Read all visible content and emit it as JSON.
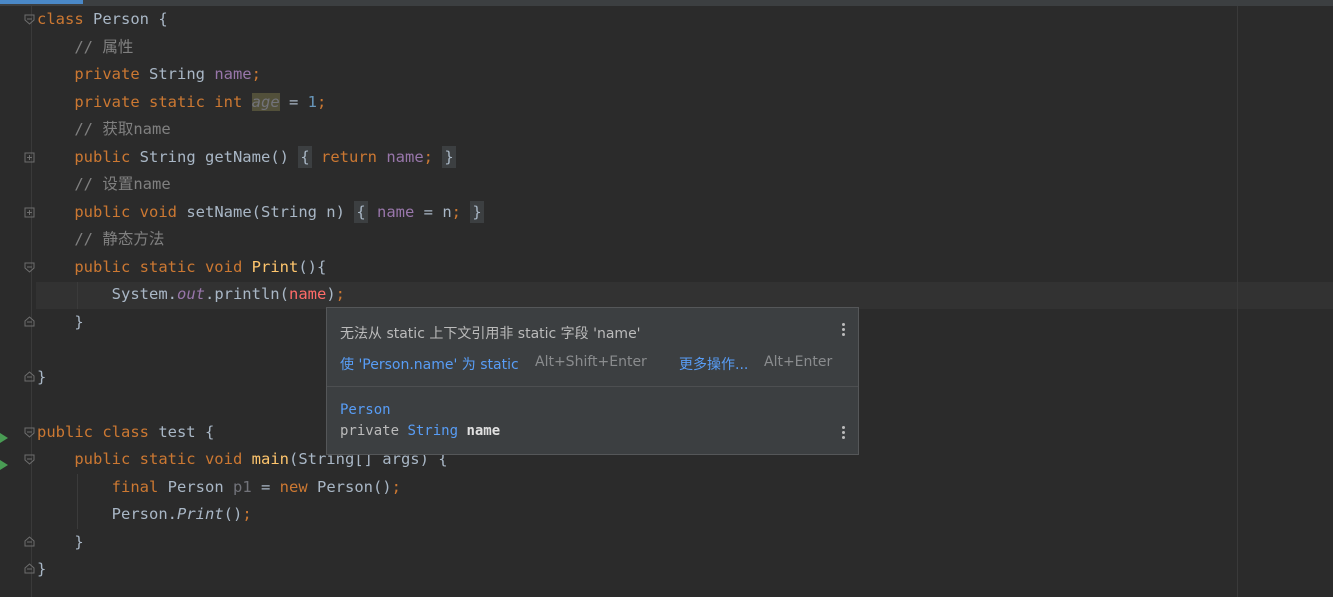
{
  "editor": {
    "lines": [
      {
        "tokens": [
          {
            "c": "kw",
            "t": "class"
          },
          {
            "c": "",
            "t": " Person {"
          }
        ]
      },
      {
        "tokens": [
          {
            "c": "",
            "t": "    "
          },
          {
            "c": "cm",
            "t": "// 属性"
          }
        ]
      },
      {
        "tokens": [
          {
            "c": "",
            "t": "    "
          },
          {
            "c": "kw",
            "t": "private"
          },
          {
            "c": "",
            "t": " String "
          },
          {
            "c": "fld",
            "t": "name"
          },
          {
            "c": "kw",
            "t": ";"
          }
        ]
      },
      {
        "tokens": [
          {
            "c": "",
            "t": "    "
          },
          {
            "c": "kw",
            "t": "private static int"
          },
          {
            "c": "",
            "t": " "
          },
          {
            "c": "hl-age",
            "t": "age"
          },
          {
            "c": "",
            "t": " = "
          },
          {
            "c": "num",
            "t": "1"
          },
          {
            "c": "kw",
            "t": ";"
          }
        ]
      },
      {
        "tokens": [
          {
            "c": "",
            "t": "    "
          },
          {
            "c": "cm",
            "t": "// 获取name"
          }
        ]
      },
      {
        "tokens": [
          {
            "c": "",
            "t": "    "
          },
          {
            "c": "kw",
            "t": "public"
          },
          {
            "c": "",
            "t": " String "
          },
          {
            "c": "mthg",
            "t": "getName"
          },
          {
            "c": "",
            "t": "() "
          },
          {
            "c": "fold-box",
            "t": "{"
          },
          {
            "c": "",
            "t": " "
          },
          {
            "c": "kw",
            "t": "return"
          },
          {
            "c": "",
            "t": " "
          },
          {
            "c": "fld",
            "t": "name"
          },
          {
            "c": "kw",
            "t": ";"
          },
          {
            "c": "",
            "t": " "
          },
          {
            "c": "fold-box",
            "t": "}"
          }
        ]
      },
      {
        "tokens": [
          {
            "c": "",
            "t": "    "
          },
          {
            "c": "cm",
            "t": "// 设置name"
          }
        ]
      },
      {
        "tokens": [
          {
            "c": "",
            "t": "    "
          },
          {
            "c": "kw",
            "t": "public void"
          },
          {
            "c": "",
            "t": " "
          },
          {
            "c": "mthg",
            "t": "setName"
          },
          {
            "c": "",
            "t": "(String n) "
          },
          {
            "c": "fold-box",
            "t": "{"
          },
          {
            "c": "",
            "t": " "
          },
          {
            "c": "fld",
            "t": "name"
          },
          {
            "c": "",
            "t": " = n"
          },
          {
            "c": "kw",
            "t": ";"
          },
          {
            "c": "",
            "t": " "
          },
          {
            "c": "fold-box",
            "t": "}"
          }
        ]
      },
      {
        "tokens": [
          {
            "c": "",
            "t": "    "
          },
          {
            "c": "cm",
            "t": "// 静态方法"
          }
        ]
      },
      {
        "tokens": [
          {
            "c": "",
            "t": "    "
          },
          {
            "c": "kw",
            "t": "public static void"
          },
          {
            "c": "",
            "t": " "
          },
          {
            "c": "mth",
            "t": "Print"
          },
          {
            "c": "",
            "t": "(){"
          }
        ]
      },
      {
        "tokens": [
          {
            "c": "",
            "t": "        System."
          },
          {
            "c": "fld ital",
            "t": "out"
          },
          {
            "c": "",
            "t": ".println("
          },
          {
            "c": "err",
            "t": "name"
          },
          {
            "c": "",
            "t": ")"
          },
          {
            "c": "kw",
            "t": ";"
          }
        ]
      },
      {
        "tokens": [
          {
            "c": "",
            "t": "    }"
          }
        ]
      },
      {
        "tokens": [
          {
            "c": "",
            "t": ""
          }
        ]
      },
      {
        "tokens": [
          {
            "c": "",
            "t": "}"
          }
        ]
      },
      {
        "tokens": [
          {
            "c": "",
            "t": ""
          }
        ]
      },
      {
        "tokens": [
          {
            "c": "kw",
            "t": "public class"
          },
          {
            "c": "",
            "t": " test {"
          }
        ]
      },
      {
        "tokens": [
          {
            "c": "",
            "t": "    "
          },
          {
            "c": "kw",
            "t": "public static void"
          },
          {
            "c": "",
            "t": " "
          },
          {
            "c": "mth",
            "t": "main"
          },
          {
            "c": "",
            "t": "(String[] args) {"
          }
        ]
      },
      {
        "tokens": [
          {
            "c": "",
            "t": "        "
          },
          {
            "c": "kw",
            "t": "final"
          },
          {
            "c": "",
            "t": " Person "
          },
          {
            "c": "unused",
            "t": "p1"
          },
          {
            "c": "",
            "t": " = "
          },
          {
            "c": "kw",
            "t": "new"
          },
          {
            "c": "",
            "t": " Person()"
          },
          {
            "c": "kw",
            "t": ";"
          }
        ]
      },
      {
        "tokens": [
          {
            "c": "",
            "t": "        Person."
          },
          {
            "c": "ital",
            "t": "Print"
          },
          {
            "c": "",
            "t": "()"
          },
          {
            "c": "kw",
            "t": ";"
          }
        ]
      },
      {
        "tokens": [
          {
            "c": "",
            "t": "    }"
          }
        ]
      },
      {
        "tokens": [
          {
            "c": "",
            "t": "}"
          }
        ]
      }
    ]
  },
  "popup": {
    "message": "无法从 static 上下文引用非 static 字段 'name'",
    "fix_label": "使 'Person.name' 为 static",
    "fix_shortcut": "Alt+Shift+Enter",
    "more_label": "更多操作...",
    "more_shortcut": "Alt+Enter",
    "doc_class": "Person",
    "doc_modifier": "private ",
    "doc_type": "String",
    "doc_name": "name"
  },
  "colors": {
    "background": "#2b2b2b",
    "keyword": "#cc7832",
    "comment": "#808080",
    "field": "#9876aa",
    "error": "#ff6b68",
    "link": "#589df6"
  }
}
